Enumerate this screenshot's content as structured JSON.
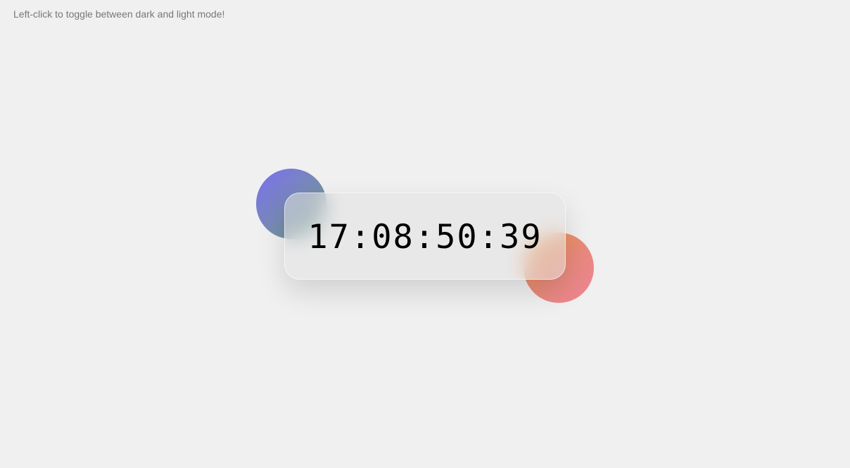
{
  "hint": "Left-click to toggle between dark and light mode!",
  "clock": {
    "time": "17:08:50:39"
  },
  "colors": {
    "background": "#f0f0f0",
    "blob1_start": "#7a6ff0",
    "blob1_end": "#6fa07a",
    "blob2_start": "#f0a040",
    "blob2_end": "#ee8399"
  }
}
